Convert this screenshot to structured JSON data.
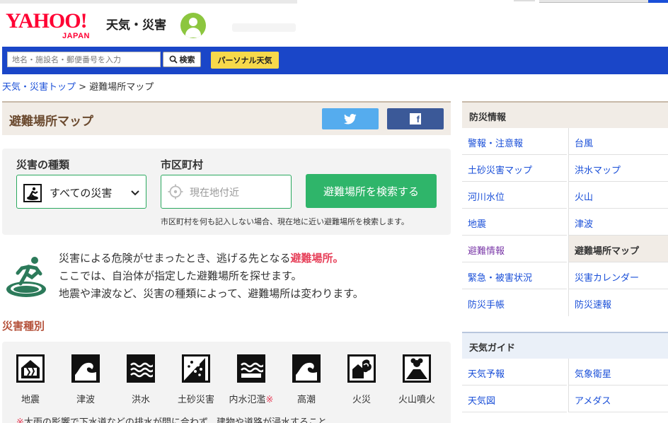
{
  "header": {
    "logo_yahoo": "YAHOO!",
    "logo_japan": "JAPAN",
    "site_title": "天気・災害"
  },
  "search": {
    "placeholder": "地名・施設名・郵便番号を入力",
    "button_label": "検索",
    "personal_label": "パーソナル天気"
  },
  "breadcrumb": {
    "top_link": "天気・災害トップ",
    "separator": ">",
    "current": "避難場所マップ"
  },
  "page": {
    "title": "避難場所マップ"
  },
  "shelter_search": {
    "disaster_type_label": "災害の種類",
    "disaster_type_value": "すべての災害",
    "city_label": "市区町村",
    "city_placeholder": "現在地付近",
    "search_button": "避難場所を検索する",
    "note": "市区町村を何も記入しない場合、現在地に近い避難場所を検索します。"
  },
  "intro": {
    "line1_prefix": "災害による危険がせまったとき、逃げる先となる",
    "line1_highlight": "避難場所。",
    "line2": "ここでは、自治体が指定した避難場所を探せます。",
    "line3": "地震や津波など、災害の種類によって、避難場所は変わります。"
  },
  "disaster_types": {
    "heading": "災害種別",
    "items": [
      {
        "label": "地震",
        "icon": "earthquake-icon"
      },
      {
        "label": "津波",
        "icon": "tsunami-icon"
      },
      {
        "label": "洪水",
        "icon": "flood-icon"
      },
      {
        "label": "土砂災害",
        "icon": "landslide-icon"
      },
      {
        "label": "内水氾濫",
        "asterisk": "※",
        "icon": "inland-flood-icon"
      },
      {
        "label": "高潮",
        "icon": "storm-surge-icon"
      },
      {
        "label": "火災",
        "icon": "fire-icon"
      },
      {
        "label": "火山噴火",
        "icon": "volcano-icon"
      }
    ],
    "note_asterisk": "※",
    "note": "大雨の影響で下水道などの排水が間に合わず、建物や道路が浸水すること"
  },
  "sidebar": {
    "bosai": {
      "heading": "防災情報",
      "items": [
        {
          "label": "警報・注意報"
        },
        {
          "label": "台風"
        },
        {
          "label": "土砂災害マップ"
        },
        {
          "label": "洪水マップ"
        },
        {
          "label": "河川水位"
        },
        {
          "label": "火山"
        },
        {
          "label": "地震"
        },
        {
          "label": "津波"
        },
        {
          "label": "避難情報",
          "state": "visited"
        },
        {
          "label": "避難場所マップ",
          "state": "current"
        },
        {
          "label": "緊急・被害状況"
        },
        {
          "label": "災害カレンダー"
        },
        {
          "label": "防災手帳"
        },
        {
          "label": "防災速報"
        }
      ]
    },
    "guide": {
      "heading": "天気ガイド",
      "items": [
        {
          "label": "天気予報"
        },
        {
          "label": "気象衛星"
        },
        {
          "label": "天気図"
        },
        {
          "label": "アメダス"
        }
      ]
    }
  },
  "colors": {
    "brand_red": "#ff0033",
    "search_bar": "#1a46c8",
    "accent_green": "#2fb56a",
    "link_blue": "#1a4fd8",
    "highlight_pink": "#e7425b",
    "twitter": "#55acee",
    "facebook": "#3b5998"
  }
}
